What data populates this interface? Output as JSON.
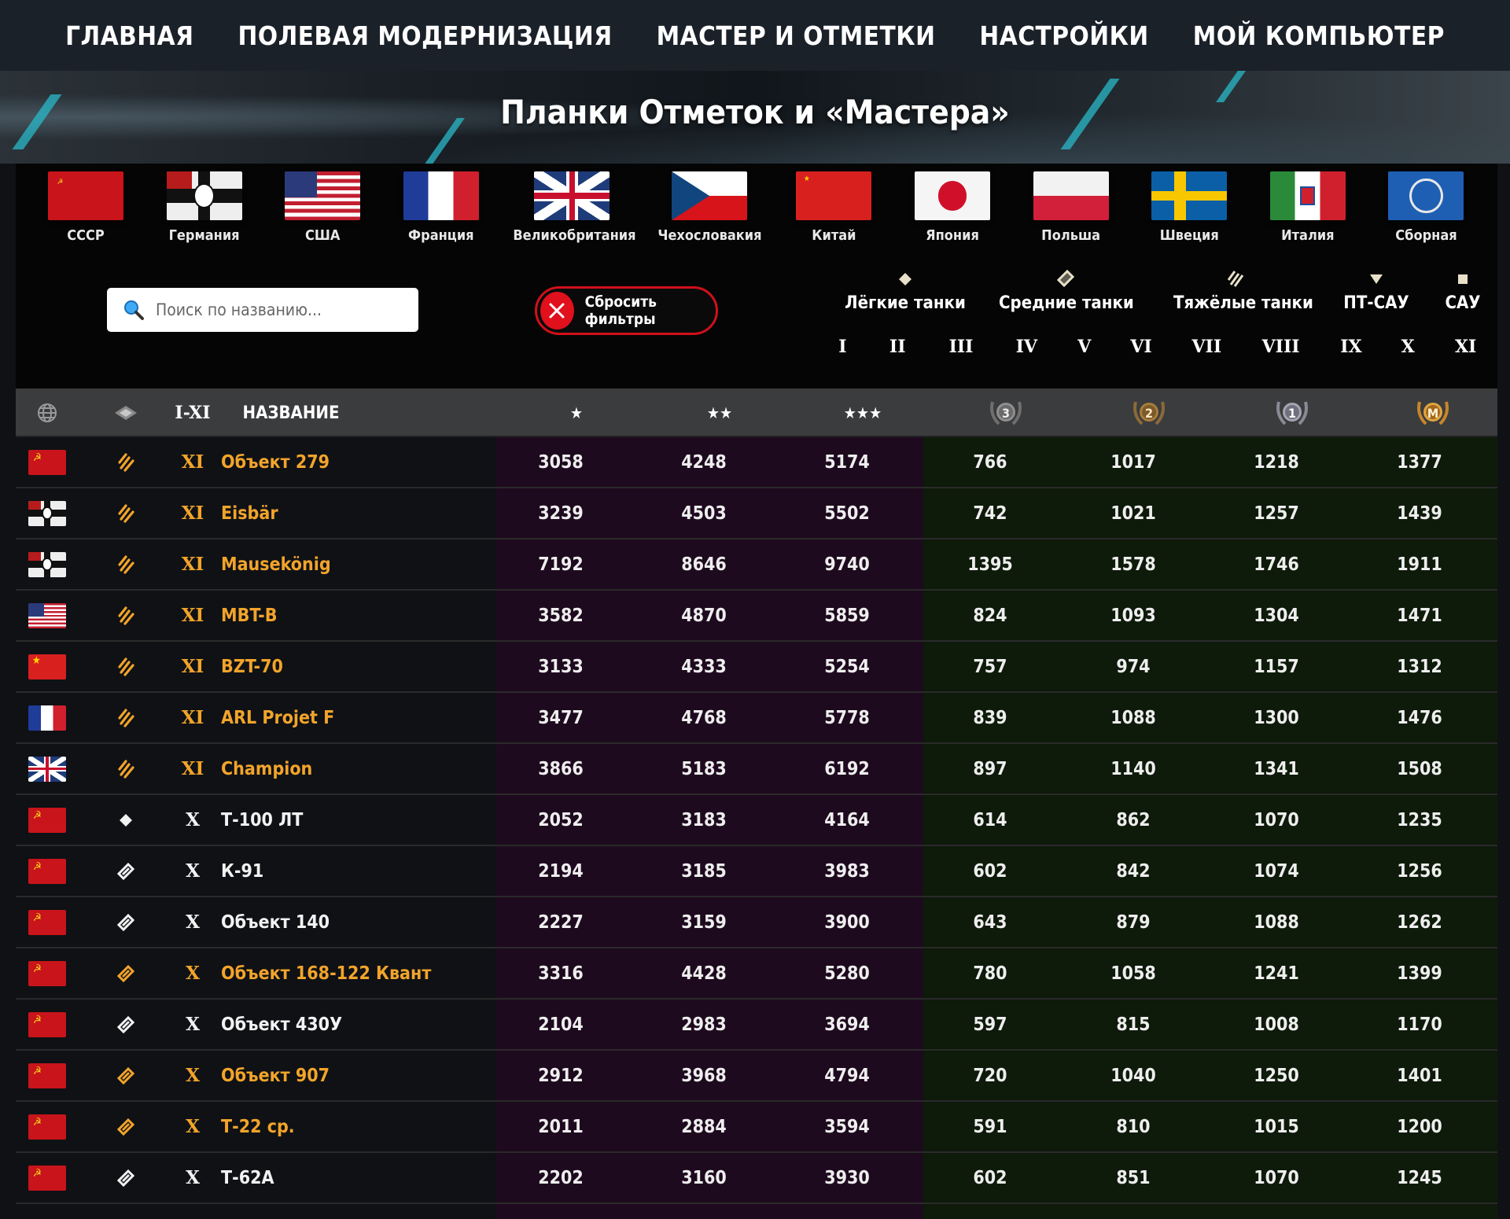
{
  "nav": {
    "items": [
      "ГЛАВНАЯ",
      "ПОЛЕВАЯ МОДЕРНИЗАЦИЯ",
      "МАСТЕР И ОТМЕТКИ",
      "НАСТРОЙКИ",
      "МОЙ КОМПЬЮТЕР"
    ]
  },
  "hero": {
    "title": "Планки Отметок и «Мастера»"
  },
  "nations": [
    {
      "label": "СССР",
      "flag": "ussr"
    },
    {
      "label": "Германия",
      "flag": "germany"
    },
    {
      "label": "США",
      "flag": "usa"
    },
    {
      "label": "Франция",
      "flag": "france"
    },
    {
      "label": "Великобритания",
      "flag": "uk"
    },
    {
      "label": "Чехословакия",
      "flag": "czech"
    },
    {
      "label": "Китай",
      "flag": "china"
    },
    {
      "label": "Япония",
      "flag": "japan"
    },
    {
      "label": "Польша",
      "flag": "poland"
    },
    {
      "label": "Швеция",
      "flag": "sweden"
    },
    {
      "label": "Италия",
      "flag": "italy"
    },
    {
      "label": "Сборная",
      "flag": "intunion"
    }
  ],
  "search": {
    "placeholder": "Поиск по названию..."
  },
  "reset": {
    "label": "Сбросить фильтры"
  },
  "types": [
    {
      "label": "Лёгкие танки",
      "icon": "light-tank-icon"
    },
    {
      "label": "Средние танки",
      "icon": "medium-tank-icon"
    },
    {
      "label": "Тяжёлые танки",
      "icon": "heavy-tank-icon"
    },
    {
      "label": "ПТ-САУ",
      "icon": "td-icon"
    },
    {
      "label": "САУ",
      "icon": "spg-icon"
    }
  ],
  "tiers": [
    "I",
    "II",
    "III",
    "IV",
    "V",
    "VI",
    "VII",
    "VIII",
    "IX",
    "X",
    "XI"
  ],
  "table": {
    "headers": {
      "nation": "globe-icon",
      "type": "tank-type-icon",
      "tier": "I-XI",
      "name": "НАЗВАНИЕ",
      "mark1": "★",
      "mark2": "★★",
      "mark3": "★★★",
      "m3": "3",
      "m2": "2",
      "m1": "1",
      "master": "M"
    },
    "rows": [
      {
        "flag": "ussr",
        "type": "heavy",
        "tier": "XI",
        "name": "Объект 279",
        "premium": true,
        "m1": "3058",
        "m2": "4248",
        "m3": "5174",
        "c3": "766",
        "c2": "1017",
        "c1": "1218",
        "cm": "1377"
      },
      {
        "flag": "germany",
        "type": "heavy",
        "tier": "XI",
        "name": "Eisbär",
        "premium": true,
        "m1": "3239",
        "m2": "4503",
        "m3": "5502",
        "c3": "742",
        "c2": "1021",
        "c1": "1257",
        "cm": "1439"
      },
      {
        "flag": "germany",
        "type": "heavy",
        "tier": "XI",
        "name": "Mausekönig",
        "premium": true,
        "m1": "7192",
        "m2": "8646",
        "m3": "9740",
        "c3": "1395",
        "c2": "1578",
        "c1": "1746",
        "cm": "1911"
      },
      {
        "flag": "usa",
        "type": "heavy",
        "tier": "XI",
        "name": "MBT-B",
        "premium": true,
        "m1": "3582",
        "m2": "4870",
        "m3": "5859",
        "c3": "824",
        "c2": "1093",
        "c1": "1304",
        "cm": "1471"
      },
      {
        "flag": "china",
        "type": "heavy",
        "tier": "XI",
        "name": "BZT-70",
        "premium": true,
        "m1": "3133",
        "m2": "4333",
        "m3": "5254",
        "c3": "757",
        "c2": "974",
        "c1": "1157",
        "cm": "1312"
      },
      {
        "flag": "france",
        "type": "heavy",
        "tier": "XI",
        "name": "ARL Projet F",
        "premium": true,
        "m1": "3477",
        "m2": "4768",
        "m3": "5778",
        "c3": "839",
        "c2": "1088",
        "c1": "1300",
        "cm": "1476"
      },
      {
        "flag": "uk",
        "type": "heavy",
        "tier": "XI",
        "name": "Champion",
        "premium": true,
        "m1": "3866",
        "m2": "5183",
        "m3": "6192",
        "c3": "897",
        "c2": "1140",
        "c1": "1341",
        "cm": "1508"
      },
      {
        "flag": "ussr",
        "type": "light",
        "tier": "X",
        "name": "Т-100 ЛТ",
        "premium": false,
        "m1": "2052",
        "m2": "3183",
        "m3": "4164",
        "c3": "614",
        "c2": "862",
        "c1": "1070",
        "cm": "1235"
      },
      {
        "flag": "ussr",
        "type": "medium",
        "tier": "X",
        "name": "К-91",
        "premium": false,
        "m1": "2194",
        "m2": "3185",
        "m3": "3983",
        "c3": "602",
        "c2": "842",
        "c1": "1074",
        "cm": "1256"
      },
      {
        "flag": "ussr",
        "type": "medium",
        "tier": "X",
        "name": "Объект 140",
        "premium": false,
        "m1": "2227",
        "m2": "3159",
        "m3": "3900",
        "c3": "643",
        "c2": "879",
        "c1": "1088",
        "cm": "1262"
      },
      {
        "flag": "ussr",
        "type": "medium",
        "tier": "X",
        "name": "Объект 168-122 Квант",
        "premium": true,
        "m1": "3316",
        "m2": "4428",
        "m3": "5280",
        "c3": "780",
        "c2": "1058",
        "c1": "1241",
        "cm": "1399"
      },
      {
        "flag": "ussr",
        "type": "medium",
        "tier": "X",
        "name": "Объект 430У",
        "premium": false,
        "m1": "2104",
        "m2": "2983",
        "m3": "3694",
        "c3": "597",
        "c2": "815",
        "c1": "1008",
        "cm": "1170"
      },
      {
        "flag": "ussr",
        "type": "medium",
        "tier": "X",
        "name": "Объект 907",
        "premium": true,
        "m1": "2912",
        "m2": "3968",
        "m3": "4794",
        "c3": "720",
        "c2": "1040",
        "c1": "1250",
        "cm": "1401"
      },
      {
        "flag": "ussr",
        "type": "medium",
        "tier": "X",
        "name": "Т-22 ср.",
        "premium": true,
        "m1": "2011",
        "m2": "2884",
        "m3": "3594",
        "c3": "591",
        "c2": "810",
        "c1": "1015",
        "cm": "1200"
      },
      {
        "flag": "ussr",
        "type": "medium",
        "tier": "X",
        "name": "Т-62А",
        "premium": false,
        "m1": "2202",
        "m2": "3160",
        "m3": "3930",
        "c3": "602",
        "c2": "851",
        "c1": "1070",
        "cm": "1245"
      }
    ]
  },
  "colors": {
    "premium": "#f2a42a",
    "marks_bg": "#1e0a1e",
    "mastery_bg": "#0e1a0a",
    "reset_red": "#e0101c"
  }
}
